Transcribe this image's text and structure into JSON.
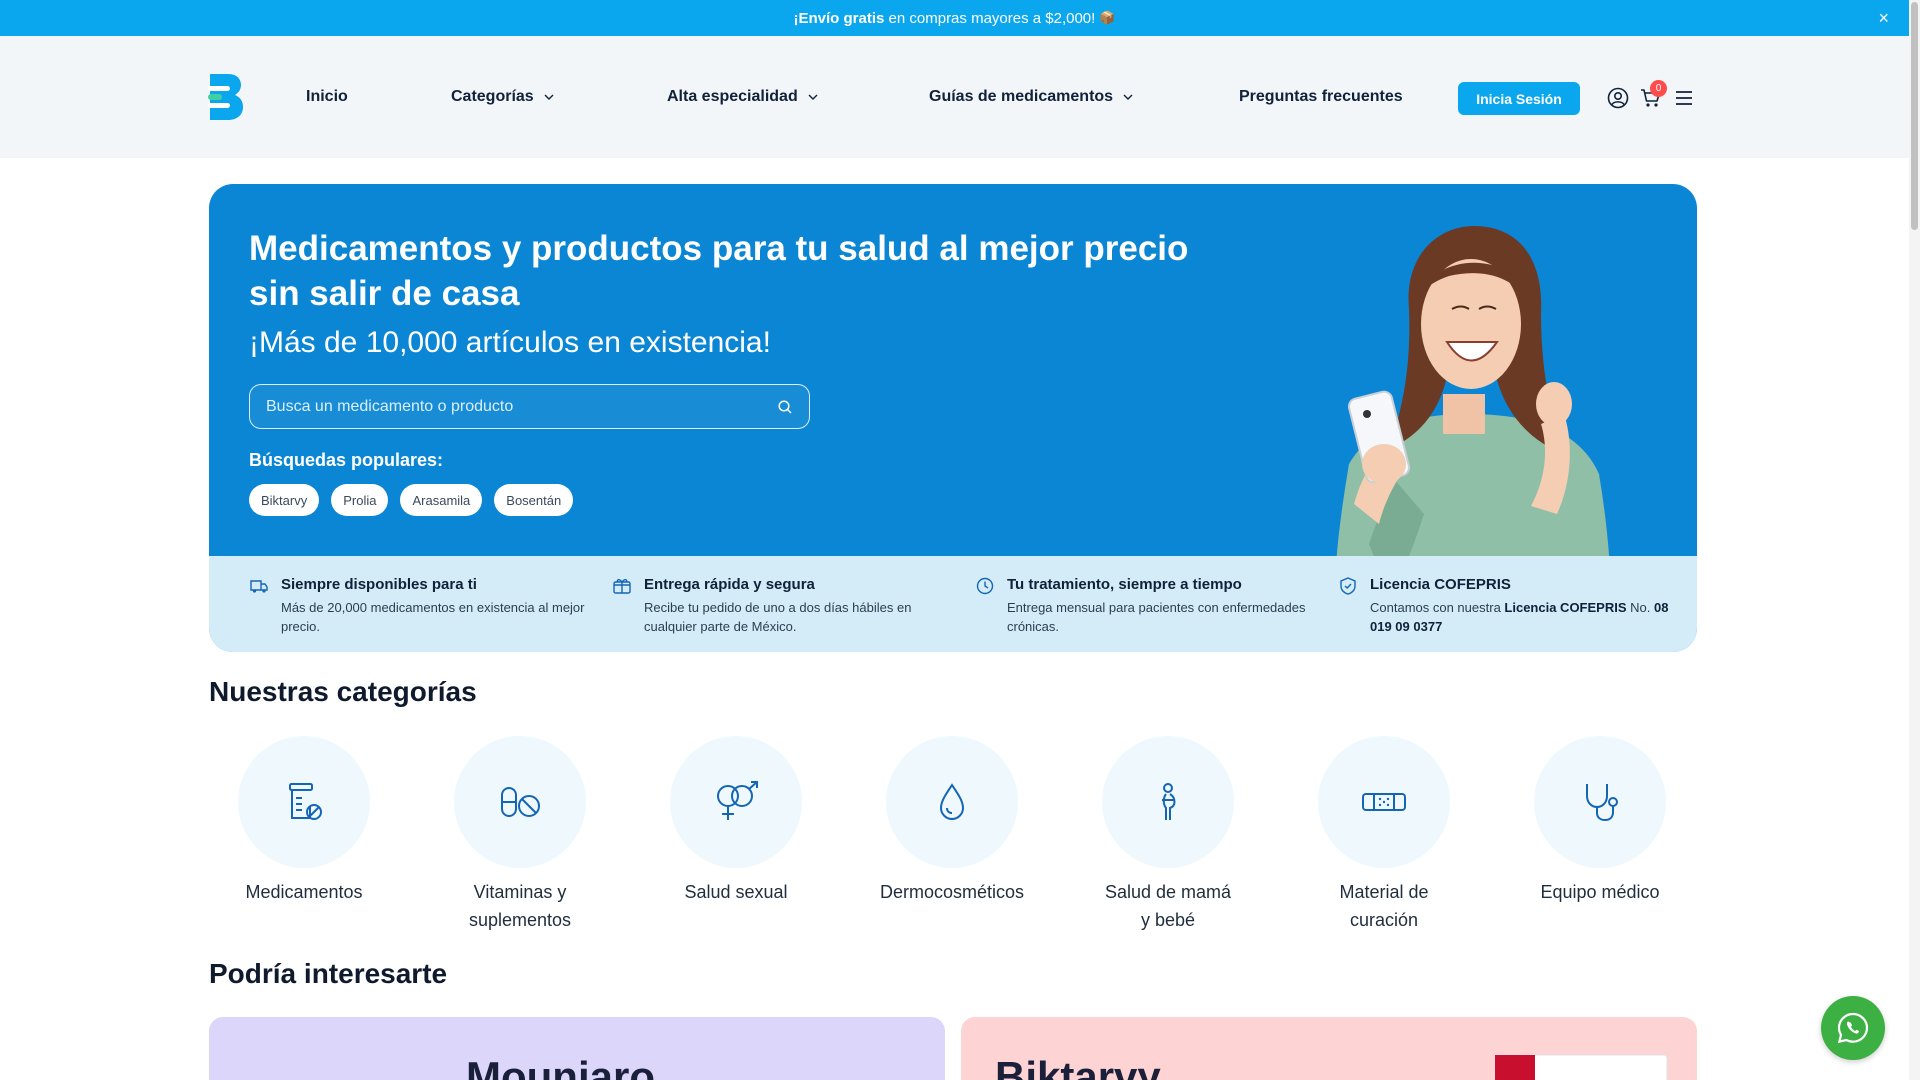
{
  "topbar": {
    "bold": "¡Envío gratis",
    "rest": "en compras mayores a $2,000!",
    "emoji": "📦",
    "close": "×"
  },
  "nav": {
    "inicio": "Inicio",
    "categorias": "Categorías",
    "alta": "Alta especialidad",
    "guias": "Guías de medicamentos",
    "preguntas": "Preguntas frecuentes",
    "login": "Inicia Sesión",
    "cart_count": "0"
  },
  "hero": {
    "title": "Medicamentos y productos para tu salud al mejor precio sin salir de casa",
    "subtitle": "¡Más de 10,000 artículos en existencia!",
    "search_placeholder": "Busca un medicamento o producto",
    "popular_label": "Búsquedas populares:",
    "chips": [
      "Biktarvy",
      "Prolia",
      "Arasamila",
      "Bosentán"
    ]
  },
  "features": [
    {
      "title": "Siempre disponibles para ti",
      "desc": "Más de 20,000 medicamentos en existencia al mejor precio."
    },
    {
      "title": "Entrega rápida y segura",
      "desc": "Recibe tu pedido de uno a dos días hábiles en cualquier parte de México."
    },
    {
      "title": "Tu tratamiento, siempre a tiempo",
      "desc": "Entrega mensual para pacientes con enfermedades crónicas."
    },
    {
      "title": "Licencia COFEPRIS",
      "desc_a": "Contamos con nuestra",
      "desc_b": "Licencia COFEPRIS",
      "desc_c": "No.",
      "desc_d": "08 019 09 0377"
    }
  ],
  "categories_title": "Nuestras categorías",
  "categories": [
    {
      "line1": "Medicamentos",
      "line2": ""
    },
    {
      "line1": "Vitaminas y",
      "line2": "suplementos"
    },
    {
      "line1": "Salud sexual",
      "line2": ""
    },
    {
      "line1": "Dermocosméticos",
      "line2": ""
    },
    {
      "line1": "Salud de mamá",
      "line2": "y bebé"
    },
    {
      "line1": "Material de",
      "line2": "curación"
    },
    {
      "line1": "Equipo médico",
      "line2": ""
    }
  ],
  "interest_title": "Podría interesarte",
  "promos": [
    {
      "title": "Mounjaro",
      "bg": "#dcd6fb"
    },
    {
      "title": "Biktarvy",
      "bg": "#fdd3d3"
    }
  ],
  "colors": {
    "accent": "#0aa7ee",
    "hero": "#0a86d4",
    "icon": "#1565b5"
  }
}
